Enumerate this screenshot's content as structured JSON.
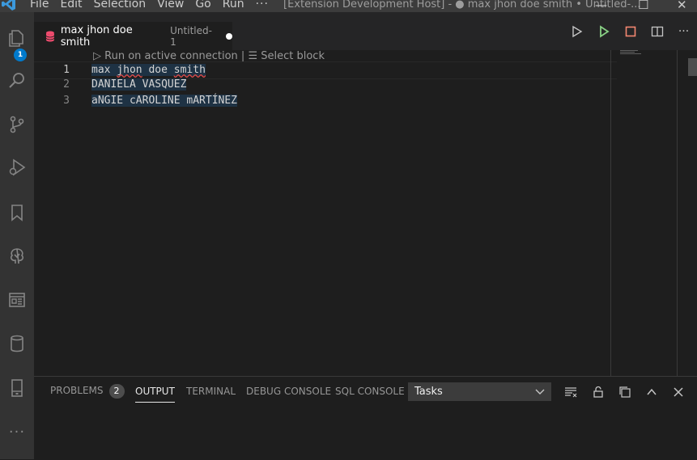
{
  "menu": {
    "items": [
      "File",
      "Edit",
      "Selection",
      "View",
      "Go",
      "Run"
    ],
    "more": "···"
  },
  "window": {
    "title": "[Extension Development Host] - ● max jhon doe smith • Untitled-..."
  },
  "activity_bar": {
    "icons": [
      "explorer-icon",
      "search-icon",
      "source-control-icon",
      "run-debug-icon",
      "bookmark-icon",
      "tree-icon",
      "dashboard-icon",
      "database-icon",
      "server-icon",
      "more-icon"
    ],
    "explorer_badge": "1",
    "more_label": "···"
  },
  "tab": {
    "name": "max jhon doe smith",
    "description": "Untitled-1",
    "dirty": true
  },
  "codelens": {
    "run": "▷ Run on active connection",
    "separator": " | ",
    "select": "☰ Select block"
  },
  "editor": {
    "lines": [
      {
        "number": "1",
        "text": "max jhon doe smith"
      },
      {
        "number": "2",
        "text": "DANIELA VASQUEZ"
      },
      {
        "number": "3",
        "text": "aNGIE cAROLINE mARTÍNEZ"
      }
    ]
  },
  "panel": {
    "tabs": [
      {
        "label": "PROBLEMS",
        "badge": "2"
      },
      {
        "label": "OUTPUT"
      },
      {
        "label": "TERMINAL"
      },
      {
        "label": "DEBUG CONSOLE"
      },
      {
        "label": "SQL CONSOLE"
      }
    ],
    "active_tab": "OUTPUT",
    "select_value": "Tasks"
  },
  "colors": {
    "accent": "#007acc",
    "run_green": "#89d185",
    "stop_red": "#f48771",
    "db_icon": "#f14c6f"
  }
}
